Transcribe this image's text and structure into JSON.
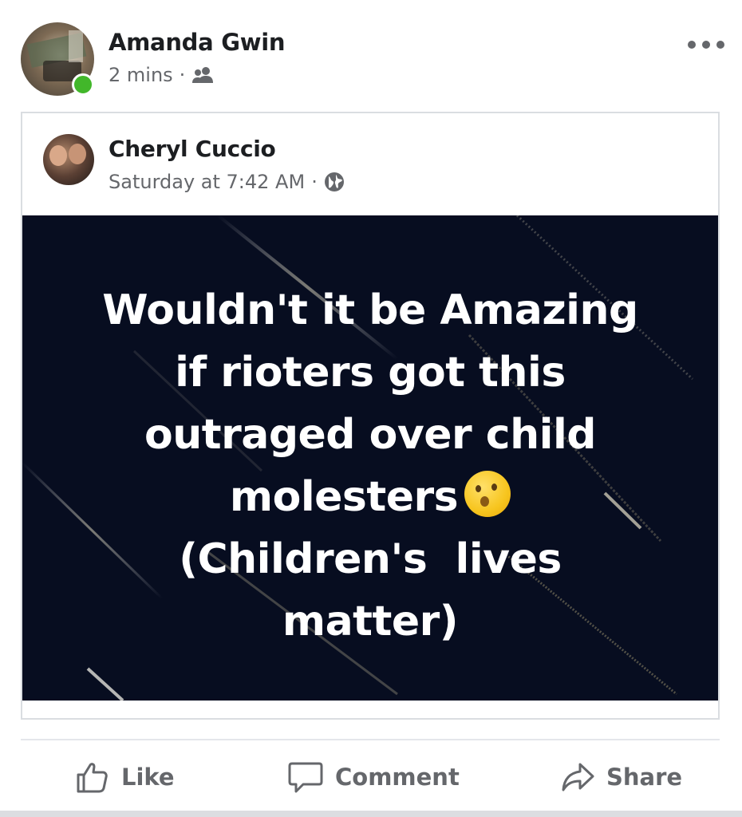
{
  "post": {
    "author": "Amanda Gwin",
    "time": "2 mins",
    "separator": "·",
    "audience_icon": "friends-icon",
    "more_icon": "more-options-icon"
  },
  "shared_post": {
    "author": "Cheryl Cuccio",
    "time": "Saturday at 7:42 AM",
    "separator": "·",
    "audience_icon": "globe-icon",
    "text_lines": [
      "Wouldn't it be Amazing",
      "if rioters got this",
      "outraged over child",
      "molesters",
      "(Children's  lives",
      "matter)"
    ],
    "emoji_icon": "thinking-face-emoji",
    "background_color": "#070d20",
    "text_color": "#ffffff"
  },
  "actions": {
    "like_label": "Like",
    "comment_label": "Comment",
    "share_label": "Share"
  },
  "colors": {
    "online": "#42b72a",
    "secondary_text": "#65676b",
    "primary_text": "#1c1e21"
  }
}
